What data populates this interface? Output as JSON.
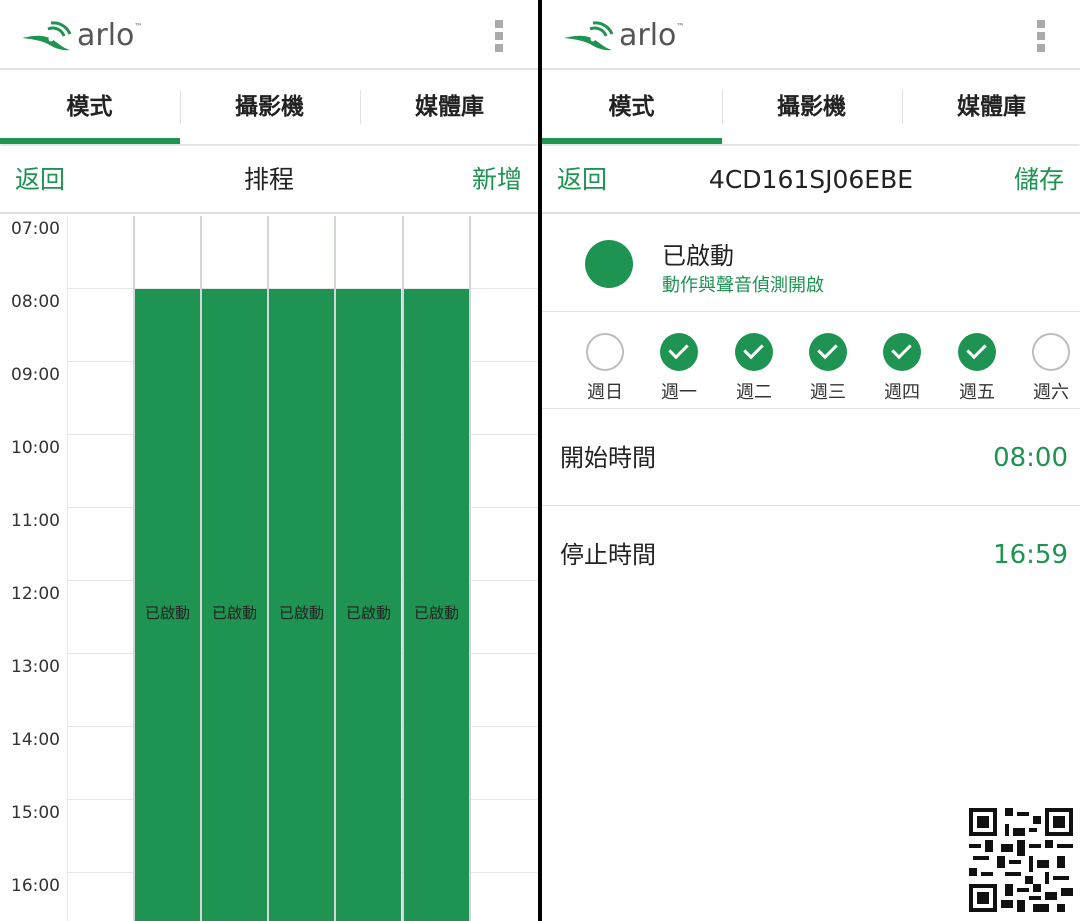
{
  "brand": {
    "logo_text": "arlo",
    "trademark": "™",
    "accent_color": "#1e9352"
  },
  "tabs": [
    {
      "label": "模式",
      "active": true
    },
    {
      "label": "攝影機",
      "active": false
    },
    {
      "label": "媒體庫",
      "active": false
    }
  ],
  "schedule_screen": {
    "back_label": "返回",
    "title": "排程",
    "add_label": "新增",
    "hours": [
      "07:00",
      "08:00",
      "09:00",
      "10:00",
      "11:00",
      "12:00",
      "13:00",
      "14:00",
      "15:00",
      "16:00"
    ],
    "blocks": [
      {
        "day": "週一",
        "label": "已啟動",
        "start": "08:00",
        "end": "16:59"
      },
      {
        "day": "週二",
        "label": "已啟動",
        "start": "08:00",
        "end": "16:59"
      },
      {
        "day": "週三",
        "label": "已啟動",
        "start": "08:00",
        "end": "16:59"
      },
      {
        "day": "週四",
        "label": "已啟動",
        "start": "08:00",
        "end": "16:59"
      },
      {
        "day": "週五",
        "label": "已啟動",
        "start": "08:00",
        "end": "16:59"
      }
    ]
  },
  "detail_screen": {
    "back_label": "返回",
    "title": "4CD161SJ06EBE",
    "save_label": "儲存",
    "status_title": "已啟動",
    "status_subtitle": "動作與聲音偵測開啟",
    "days": [
      {
        "label": "週日",
        "checked": false
      },
      {
        "label": "週一",
        "checked": true
      },
      {
        "label": "週二",
        "checked": true
      },
      {
        "label": "週三",
        "checked": true
      },
      {
        "label": "週四",
        "checked": true
      },
      {
        "label": "週五",
        "checked": true
      },
      {
        "label": "週六",
        "checked": false
      }
    ],
    "start_time_label": "開始時間",
    "start_time_value": "08:00",
    "stop_time_label": "停止時間",
    "stop_time_value": "16:59"
  }
}
